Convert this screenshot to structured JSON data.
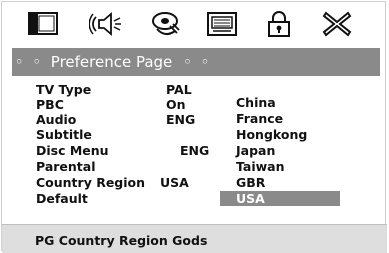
{
  "toolbar": {
    "icons": [
      {
        "name": "tv-display-icon"
      },
      {
        "name": "speaker-audio-icon"
      },
      {
        "name": "dolby-disc-icon"
      },
      {
        "name": "video-screen-icon"
      },
      {
        "name": "lock-icon"
      },
      {
        "name": "close-exit-icon"
      }
    ]
  },
  "page": {
    "title_dots_left": "◦ ◦",
    "title": "Preference Page",
    "title_dots_right": "◦ ◦"
  },
  "settings": [
    {
      "label": "TV Type",
      "value": "PAL"
    },
    {
      "label": "PBC",
      "value": "On"
    },
    {
      "label": "Audio",
      "value": "ENG"
    },
    {
      "label": "Subtitle",
      "value": ""
    },
    {
      "label": "Disc Menu",
      "value": "ENG"
    },
    {
      "label": "Parental",
      "value": ""
    },
    {
      "label": "Country Region",
      "value": "USA"
    },
    {
      "label": "Default",
      "value": ""
    }
  ],
  "country_options": [
    "China",
    "France",
    "Hongkong",
    "Japan",
    "Taiwan",
    "GBR",
    "USA"
  ],
  "selected_option": "USA",
  "status": {
    "text": "PG Country Region Gods"
  },
  "colors": {
    "title_bar_bg": "#8a8a8a",
    "selected_bg": "#8a8a8a",
    "status_bg": "#dedede"
  }
}
